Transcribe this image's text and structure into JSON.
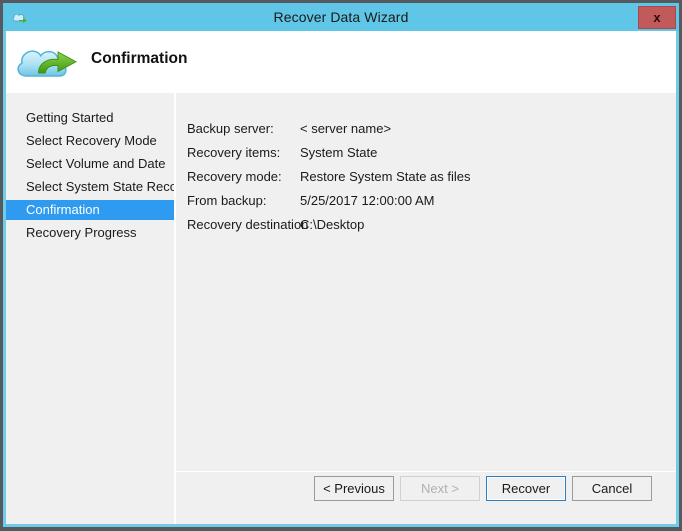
{
  "window": {
    "title": "Recover Data Wizard",
    "title_icon": "cloud-arrow-icon",
    "close_label": "x",
    "frame_color": "#555a5e",
    "accent_color": "#5fc6e8"
  },
  "header": {
    "page_title": "Confirmation",
    "logo_icon": "cloud-recovery-icon"
  },
  "sidebar": {
    "items": [
      {
        "label": "Getting Started",
        "selected": false
      },
      {
        "label": "Select Recovery Mode",
        "selected": false
      },
      {
        "label": "Select Volume and Date",
        "selected": false
      },
      {
        "label": "Select System State Reco...",
        "selected": false
      },
      {
        "label": "Confirmation",
        "selected": true
      },
      {
        "label": "Recovery Progress",
        "selected": false
      }
    ],
    "selected_color": "#2f9bf0"
  },
  "content": {
    "details": [
      {
        "label": "Backup server:",
        "value": "< server name>"
      },
      {
        "label": "Recovery items:",
        "value": "System State"
      },
      {
        "label": "Recovery mode:",
        "value": "Restore System State as files"
      },
      {
        "label": "From backup:",
        "value": "5/25/2017 12:00:00 AM"
      },
      {
        "label": "Recovery destination",
        "value": "C:\\Desktop"
      }
    ]
  },
  "footer": {
    "buttons": [
      {
        "label": "< Previous",
        "state": "enabled"
      },
      {
        "label": "Next >",
        "state": "disabled"
      },
      {
        "label": "Recover",
        "state": "default"
      },
      {
        "label": "Cancel",
        "state": "enabled"
      }
    ]
  }
}
